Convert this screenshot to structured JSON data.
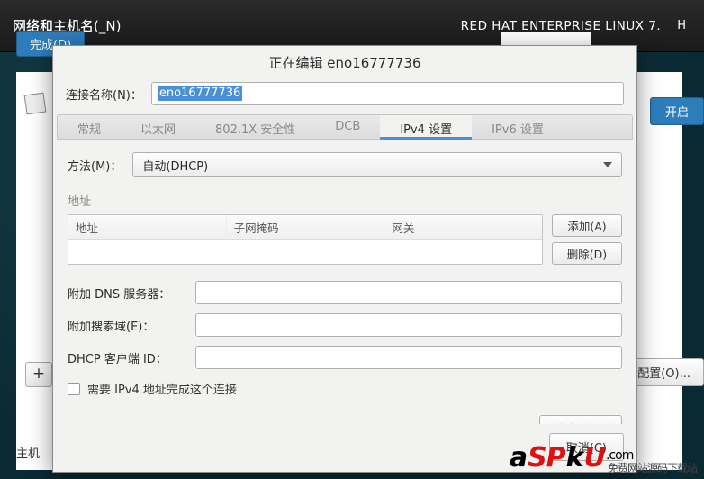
{
  "topbar": {
    "title": "网络和主机名(_N)",
    "brand": "RED HAT ENTERPRISE LINUX 7.",
    "help": "H",
    "done": "完成(D)"
  },
  "sidebar": {
    "plus": "+",
    "hostname_label": "主机"
  },
  "right_buttons": {
    "on": "开启",
    "configure": "配置(O)..."
  },
  "dialog": {
    "title": "正在编辑 eno16777736",
    "name_label": "连接名称(N)：",
    "name_value": "eno16777736",
    "tabs": [
      "常规",
      "以太网",
      "802.1X 安全性",
      "DCB",
      "IPv4 设置",
      "IPv6 设置"
    ],
    "active_tab_index": 4,
    "method_label": "方法(M)：",
    "method_value": "自动(DHCP)",
    "address": {
      "section_label": "地址",
      "headers": [
        "地址",
        "子网掩码",
        "网关"
      ]
    },
    "add_btn": "添加(A)",
    "del_btn": "删除(D)",
    "dns_label": "附加 DNS 服务器：",
    "searchdomains_label": "附加搜索域(E)：",
    "dhcp_client_label": "DHCP 客户端 ID：",
    "require_ipv4_label": "需要 IPv4 地址完成这个连接",
    "route_btn": "路由(R)…",
    "cancel_btn": "取消(C)"
  },
  "watermark": {
    "t1": "a",
    "t2": "SP",
    "t3": "k",
    "t4": "U",
    "suffix": ".com",
    "sub": "免费网站源码下载站"
  }
}
